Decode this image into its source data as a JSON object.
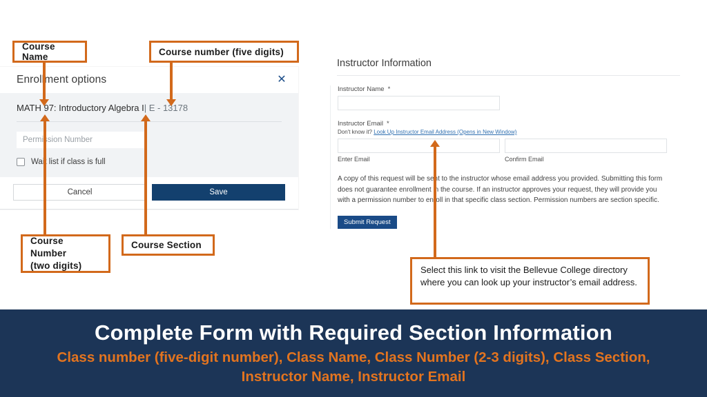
{
  "dialog": {
    "title": "Enrollment options",
    "close_icon": "close-icon",
    "course_name": "MATH 97: Introductory Algebra I",
    "course_section": "| E - 13178",
    "permission_placeholder": "Permission Number",
    "waitlist_label": "Wait list if class is full",
    "cancel_label": "Cancel",
    "save_label": "Save"
  },
  "form": {
    "heading": "Instructor Information",
    "instructor_name_label": "Instructor Name",
    "required_mark": "*",
    "instructor_name_value": "",
    "instructor_email_label": "Instructor Email",
    "hint_prefix": "Don't know it?",
    "hint_link": "Look Up Instructor Email Address (Opens in New Window)",
    "enter_email_label": "Enter Email",
    "confirm_email_label": "Confirm Email",
    "enter_email_value": "",
    "confirm_email_value": "",
    "disclaimer": "A copy of this request will be sent to the instructor whose email address you provided. Submitting this form does not guarantee enrollment in the course. If an instructor approves your request, they will provide you with a permission number to enroll in that specific class section. Permission numbers are section specific.",
    "submit_label": "Submit Request"
  },
  "annotations": {
    "course_name": "Course  Name",
    "course_number_five": "Course  number  (five digits)",
    "course_number_two_l1": "Course  Number",
    "course_number_two_l2": "(two digits)",
    "course_section": "Course  Section",
    "link_note": "Select this link to visit the Bellevue  College directory where you can look up your instructor’s email address."
  },
  "banner": {
    "title": "Complete Form with Required Section Information",
    "subtitle": "Class number (five-digit number), Class Name, Class Number (2-3 digits), Class Section, Instructor Name, Instructor Email"
  },
  "colors": {
    "annotation_orange": "#d2691b",
    "banner_navy": "#1c3557",
    "banner_subtitle_orange": "#e3741f",
    "primary_navy": "#13406e",
    "link_blue": "#2f6fb0"
  }
}
